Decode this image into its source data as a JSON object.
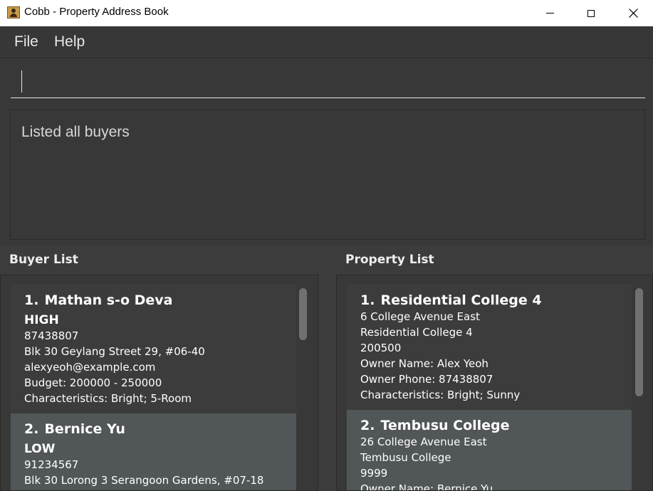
{
  "window": {
    "title": "Cobb - Property Address Book"
  },
  "menu": {
    "items": [
      "File",
      "Help"
    ]
  },
  "command": {
    "value": ""
  },
  "result": {
    "text": "Listed all buyers"
  },
  "buyer_list": {
    "title": "Buyer List",
    "buyers": [
      {
        "index": "1.",
        "name": "Mathan s-o Deva",
        "priority": "HIGH",
        "phone": "87438807",
        "address": "Blk 30 Geylang Street 29, #06-40",
        "email": "alexyeoh@example.com",
        "budget": "Budget: 200000 - 250000",
        "characteristics": "Characteristics: Bright; 5-Room"
      },
      {
        "index": "2.",
        "name": "Bernice Yu",
        "priority": "LOW",
        "phone": "91234567",
        "address": "Blk 30 Lorong 3 Serangoon Gardens, #07-18"
      }
    ]
  },
  "property_list": {
    "title": "Property List",
    "properties": [
      {
        "index": "1.",
        "name": "Residential College 4",
        "address": "6 College Avenue East",
        "description": "Residential College 4",
        "price": "200500",
        "owner_name": "Owner Name: Alex Yeoh",
        "owner_phone": "Owner Phone: 87438807",
        "characteristics": "Characteristics: Bright; Sunny"
      },
      {
        "index": "2.",
        "name": "Tembusu College",
        "address": "26 College Avenue East",
        "description": "Tembusu College",
        "price": "9999",
        "owner_name": "Owner Name: Bernice Yu"
      }
    ]
  },
  "colors": {
    "background": "#3c3c3c",
    "selected_card": "#515658",
    "text": "#ffffff"
  }
}
